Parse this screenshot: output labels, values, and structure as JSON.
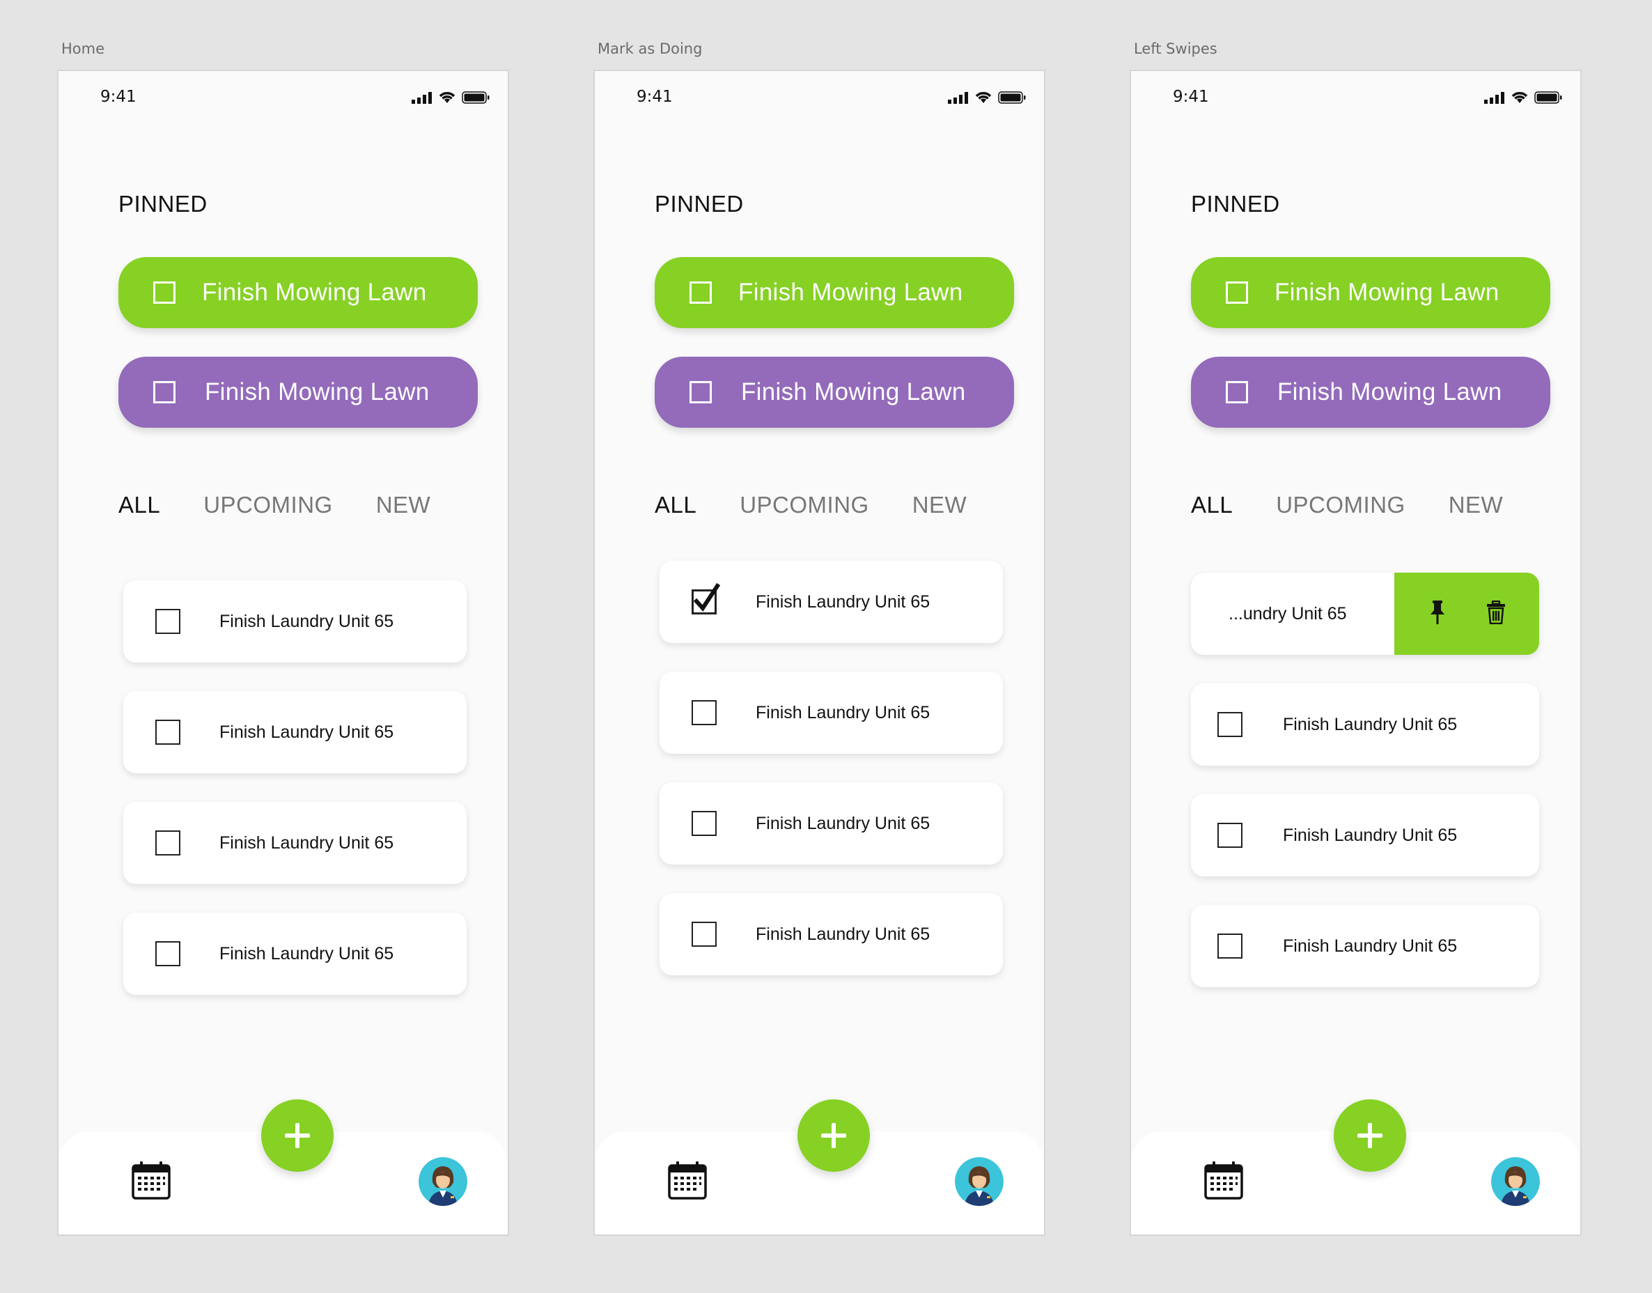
{
  "colors": {
    "accent_green": "#86d124",
    "accent_purple": "#936bba",
    "canvas": "#e4e4e4"
  },
  "screens": [
    {
      "label": "Home",
      "status": {
        "time": "9:41"
      },
      "pinned": {
        "title": "PINNED",
        "items": [
          {
            "label": "Finish Mowing Lawn"
          },
          {
            "label": "Finish Mowing Lawn"
          }
        ]
      },
      "tabs": [
        {
          "label": "ALL"
        },
        {
          "label": "UPCOMING"
        },
        {
          "label": "NEW"
        }
      ],
      "tasks": [
        {
          "label": "Finish Laundry Unit 65"
        },
        {
          "label": "Finish Laundry Unit 65"
        },
        {
          "label": "Finish Laundry Unit 65"
        },
        {
          "label": "Finish Laundry Unit 65"
        }
      ]
    },
    {
      "label": "Mark as Doing",
      "status": {
        "time": "9:41"
      },
      "pinned": {
        "title": "PINNED",
        "items": [
          {
            "label": "Finish Mowing Lawn"
          },
          {
            "label": "Finish Mowing Lawn"
          }
        ]
      },
      "tabs": [
        {
          "label": "ALL"
        },
        {
          "label": "UPCOMING"
        },
        {
          "label": "NEW"
        }
      ],
      "tasks": [
        {
          "label": "Finish Laundry Unit 65",
          "checked": true
        },
        {
          "label": "Finish Laundry Unit 65"
        },
        {
          "label": "Finish Laundry Unit 65"
        },
        {
          "label": "Finish Laundry Unit 65"
        }
      ]
    },
    {
      "label": "Left Swipes",
      "status": {
        "time": "9:41"
      },
      "pinned": {
        "title": "PINNED",
        "items": [
          {
            "label": "Finish Mowing Lawn"
          },
          {
            "label": "Finish Mowing Lawn"
          }
        ]
      },
      "tabs": [
        {
          "label": "ALL"
        },
        {
          "label": "UPCOMING"
        },
        {
          "label": "NEW"
        }
      ],
      "swiped_task": {
        "label": "...undry Unit 65",
        "actions": [
          "pin-icon",
          "trash-icon"
        ]
      },
      "tasks": [
        {
          "label": "Finish Laundry Unit 65"
        },
        {
          "label": "Finish Laundry Unit 65"
        },
        {
          "label": "Finish Laundry Unit 65"
        }
      ]
    }
  ],
  "nav": {
    "left_icon": "calendar-icon",
    "center_icon": "plus-icon",
    "right_icon": "avatar"
  }
}
